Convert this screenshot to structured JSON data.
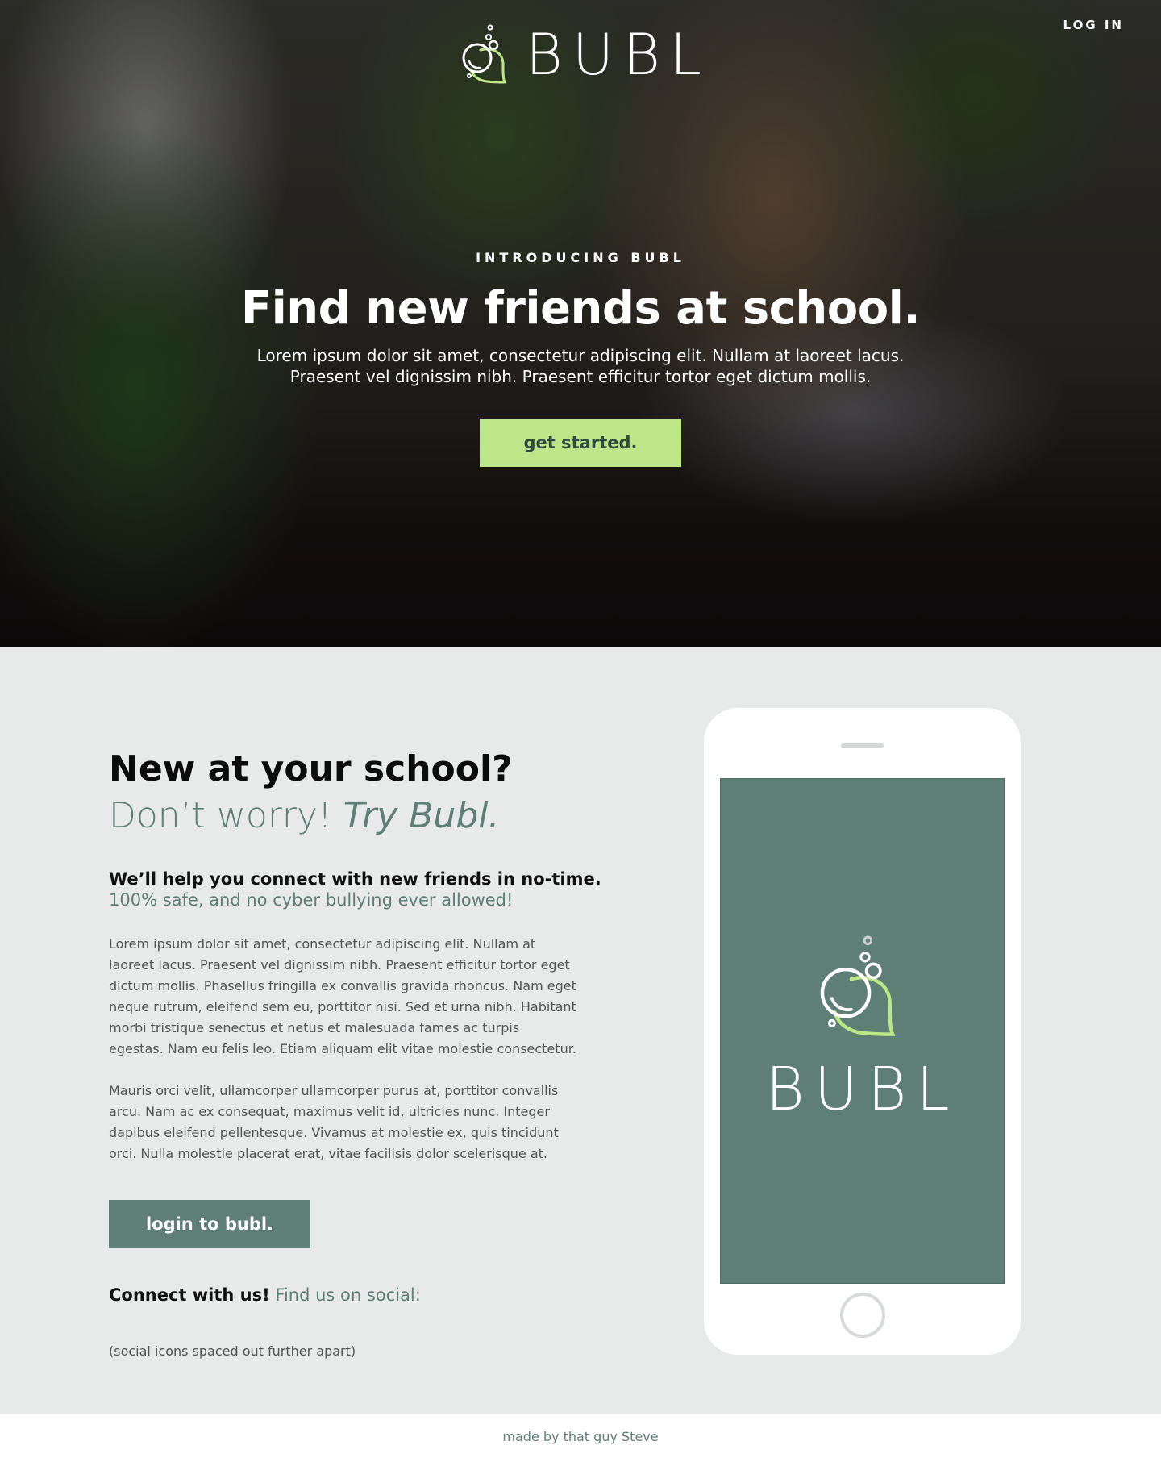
{
  "colors": {
    "accent_green": "#bce687",
    "brand_teal": "#5e7e76",
    "page_bg": "#e8eae9"
  },
  "header": {
    "logo_text": "BUBL",
    "logo_icon": "bubbles-chat-icon",
    "login_link": "LOG IN"
  },
  "hero": {
    "eyebrow": "INTRODUCING BUBL",
    "title": "Find new friends at school.",
    "subtitle_line1": "Lorem ipsum dolor sit amet, consectetur adipiscing elit. Nullam at laoreet lacus.",
    "subtitle_line2": "Praesent vel dignissim nibh. Praesent efficitur tortor eget dictum mollis.",
    "cta_label": "get started."
  },
  "main": {
    "heading": "New at your school?",
    "subheading_plain": "Don’t worry! ",
    "subheading_italic": "Try Bubl.",
    "lead_strong": "We’ll help you connect with new friends in no-time.",
    "lead_muted": "100% safe, and no cyber bullying ever allowed!",
    "paragraph1": "Lorem ipsum dolor sit amet, consectetur adipiscing elit. Nullam at laoreet lacus. Praesent vel dignissim nibh. Praesent efficitur tortor eget dictum mollis. Phasellus fringilla ex convallis gravida rhoncus. Nam eget neque rutrum, eleifend sem eu, porttitor nisi. Sed et urna nibh. Habitant morbi tristique senectus et netus et malesuada fames ac turpis egestas. Nam eu felis leo. Etiam aliquam elit vitae molestie consectetur.",
    "paragraph2": "Mauris orci velit, ullamcorper ullamcorper purus at, porttitor convallis arcu. Nam ac ex consequat, maximus velit id, ultricies nunc. Integer dapibus eleifend pellentesque. Vivamus at molestie ex, quis tincidunt orci. Nulla molestie placerat erat, vitae facilisis dolor scelerisque at.",
    "login_button": "login to bubl.",
    "connect_strong": "Connect with us!",
    "connect_muted": " Find us on social:",
    "social_note": "(social icons spaced out further apart)"
  },
  "phone": {
    "screen_text": "BUBL"
  },
  "footer": {
    "credit": "made by that guy Steve"
  }
}
